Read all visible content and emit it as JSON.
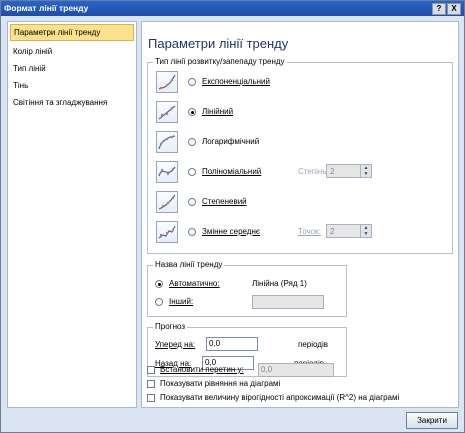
{
  "window": {
    "title": "Формат лінії тренду",
    "help_label": "?",
    "close_label": "X"
  },
  "sidebar": {
    "items": [
      {
        "label": "Параметри лінії тренду"
      },
      {
        "label": "Колір ліній"
      },
      {
        "label": "Тип ліній"
      },
      {
        "label": "Тінь"
      },
      {
        "label": "Світіння та згладжування"
      }
    ]
  },
  "main": {
    "title": "Параметри лінії тренду",
    "type_group": {
      "title": "Тип лінії розвитку/запепаду тренду",
      "options": [
        {
          "label": "Експоненціальний",
          "icon": "exponential-trend-icon",
          "selected": false
        },
        {
          "label": "Лінійний",
          "icon": "linear-trend-icon",
          "selected": true
        },
        {
          "label": "Логарифмічний",
          "icon": "logarithmic-trend-icon",
          "selected": false
        },
        {
          "label": "Поліноміальний",
          "icon": "polynomial-trend-icon",
          "selected": false
        },
        {
          "label": "Степеневий",
          "icon": "power-trend-icon",
          "selected": false
        },
        {
          "label": "Змінне середнє",
          "icon": "moving-average-trend-icon",
          "selected": false
        }
      ],
      "degree_label": "Степінь:",
      "degree_value": "2",
      "period_label": "Точок:",
      "period_value": "2"
    },
    "name_group": {
      "title": "Назва лінії тренду",
      "auto_label": "Автоматично:",
      "auto_value": "Лінійна (Ряд 1)",
      "custom_label": "Інший:",
      "custom_value": ""
    },
    "forecast_group": {
      "title": "Прогноз",
      "forward_label": "Уперед на:",
      "forward_value": "0,0",
      "forward_unit": "періодів",
      "backward_label": "Назад на:",
      "backward_value": "0,0",
      "backward_unit": "періодів"
    },
    "intercept_label": "Встановити перетин у:",
    "intercept_value": "0,0",
    "show_equation_label": "Показувати рівняння на діаграмі",
    "show_r2_label": "Показувати величину вірогідності апроксимації (R^2) на діаграмі"
  },
  "footer": {
    "close_button": "Закрити"
  }
}
